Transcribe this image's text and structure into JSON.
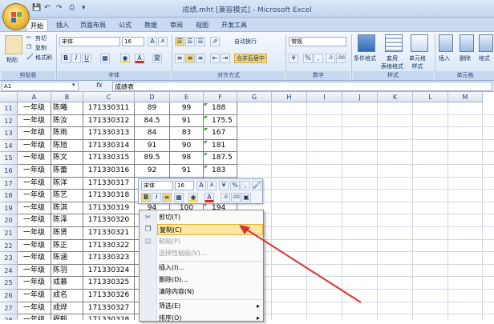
{
  "window": {
    "title": "成绩.mht [兼容模式] - Microsoft Excel"
  },
  "qat": {
    "icons": [
      "save-icon",
      "undo-icon",
      "redo-icon",
      "print-preview-icon"
    ]
  },
  "tabs": [
    "开始",
    "插入",
    "页面布局",
    "公式",
    "数据",
    "审阅",
    "视图",
    "开发工具"
  ],
  "ribbon": {
    "clipboard": {
      "paste": "粘贴",
      "cut": "剪切",
      "copy": "复制",
      "format_painter": "格式刷",
      "group": "剪贴板"
    },
    "font": {
      "name": "宋体",
      "size": "16",
      "bold": "B",
      "italic": "I",
      "underline": "U",
      "grow": "A",
      "shrink": "A",
      "font_color": "A",
      "group": "字体",
      "wen": "變"
    },
    "alignment": {
      "wrap": "自动换行",
      "merge": "合并后居中",
      "group": "对齐方式"
    },
    "number": {
      "format": "常规",
      "percent": "%",
      "comma": ",",
      "group": "数字"
    },
    "styles": {
      "conditional": "条件格式",
      "table": "套用\n表格格式",
      "cell": "单元格\n样式",
      "group": "样式"
    },
    "cells": {
      "insert": "插入",
      "delete": "删除",
      "format": "格式",
      "group": "单元格"
    }
  },
  "formula_bar": {
    "name_box": "A1",
    "fx": "fx",
    "content": "成绩表"
  },
  "columns": [
    "A",
    "B",
    "C",
    "D",
    "E",
    "F",
    "G",
    "H",
    "I",
    "J",
    "K",
    "L",
    "M"
  ],
  "rows": [
    {
      "num": "11",
      "a": "一年级",
      "b": "陈曦",
      "c": "171330311",
      "d": "89",
      "e": "99",
      "f": "188"
    },
    {
      "num": "12",
      "a": "一年级",
      "b": "陈汝",
      "c": "171330312",
      "d": "84.5",
      "e": "91",
      "f": "175.5"
    },
    {
      "num": "13",
      "a": "一年级",
      "b": "陈雨",
      "c": "171330313",
      "d": "84",
      "e": "83",
      "f": "167"
    },
    {
      "num": "14",
      "a": "一年级",
      "b": "陈旭",
      "c": "171330314",
      "d": "91",
      "e": "90",
      "f": "181"
    },
    {
      "num": "15",
      "a": "一年级",
      "b": "陈文",
      "c": "171330315",
      "d": "89.5",
      "e": "98",
      "f": "187.5"
    },
    {
      "num": "16",
      "a": "一年级",
      "b": "陈蕾",
      "c": "171330316",
      "d": "92",
      "e": "91",
      "f": "183"
    },
    {
      "num": "17",
      "a": "一年级",
      "b": "陈洋",
      "c": "171330317",
      "d": "",
      "e": "",
      "f": ""
    },
    {
      "num": "18",
      "a": "一年级",
      "b": "陈艺",
      "c": "171330318",
      "d": "",
      "e": "",
      "f": ""
    },
    {
      "num": "19",
      "a": "一年级",
      "b": "陈淇",
      "c": "171330319",
      "d": "94",
      "e": "100",
      "f": "194"
    },
    {
      "num": "20",
      "a": "一年级",
      "b": "陈泽",
      "c": "171330320",
      "d": "",
      "e": "",
      "f": ""
    },
    {
      "num": "21",
      "a": "一年级",
      "b": "陈贤",
      "c": "171330321",
      "d": "",
      "e": "",
      "f": ""
    },
    {
      "num": "22",
      "a": "一年级",
      "b": "陈正",
      "c": "171330322",
      "d": "",
      "e": "",
      "f": ""
    },
    {
      "num": "23",
      "a": "一年级",
      "b": "陈涵",
      "c": "171330323",
      "d": "",
      "e": "",
      "f": ""
    },
    {
      "num": "24",
      "a": "一年级",
      "b": "陈羽",
      "c": "171330324",
      "d": "",
      "e": "",
      "f": ""
    },
    {
      "num": "25",
      "a": "一年级",
      "b": "成慕",
      "c": "171330325",
      "d": "",
      "e": "",
      "f": ""
    },
    {
      "num": "26",
      "a": "一年级",
      "b": "成名",
      "c": "171330326",
      "d": "",
      "e": "",
      "f": ""
    },
    {
      "num": "27",
      "a": "一年级",
      "b": "成烨",
      "c": "171330327",
      "d": "",
      "e": "",
      "f": ""
    },
    {
      "num": "28",
      "a": "一年级",
      "b": "程毅",
      "c": "171330328",
      "d": "",
      "e": "",
      "f": ""
    }
  ],
  "mini_toolbar": {
    "font": "宋体",
    "size": "16",
    "bold": "B",
    "italic": "I",
    "percent": "%",
    "comma": ","
  },
  "context_menu": [
    {
      "label": "剪切(T)",
      "icon": "scissors-icon",
      "state": "normal"
    },
    {
      "label": "复制(C)",
      "icon": "copy-icon",
      "state": "highlighted"
    },
    {
      "label": "粘贴(P)",
      "icon": "paste-icon",
      "state": "disabled"
    },
    {
      "label": "选择性粘贴(V)...",
      "icon": "",
      "state": "disabled"
    },
    {
      "label": "插入(I)...",
      "icon": "",
      "state": "normal"
    },
    {
      "label": "删除(D)...",
      "icon": "",
      "state": "normal"
    },
    {
      "label": "清除内容(N)",
      "icon": "",
      "state": "normal"
    },
    {
      "label": "筛选(E)",
      "icon": "",
      "state": "normal",
      "submenu": true
    },
    {
      "label": "排序(O)",
      "icon": "",
      "state": "normal",
      "submenu": true
    }
  ],
  "colors": {
    "accent": "#e03030",
    "highlight": "#ffe7a2",
    "ribbon": "#d7e5f6"
  }
}
